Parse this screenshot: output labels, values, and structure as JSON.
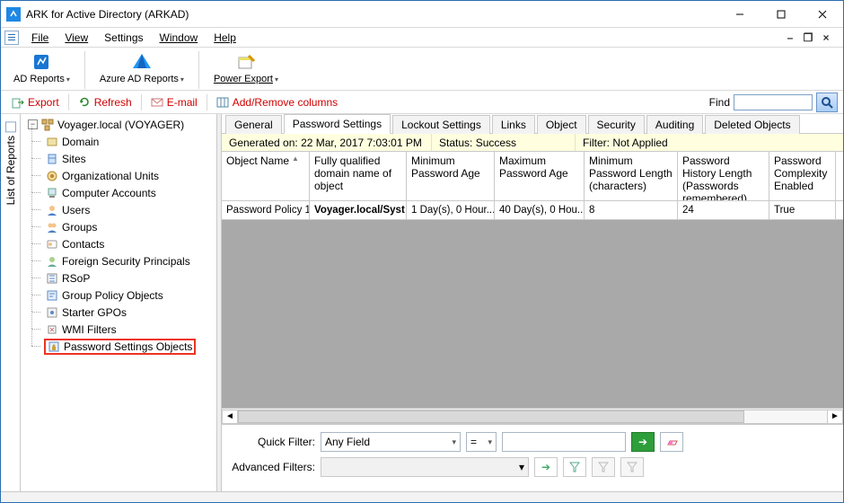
{
  "window": {
    "title": "ARK for Active Directory (ARKAD)"
  },
  "menu": {
    "file": "File",
    "view": "View",
    "settings": "Settings",
    "window": "Window",
    "help": "Help"
  },
  "ribbon": {
    "ad_reports": "AD Reports",
    "azure_reports": "Azure AD Reports",
    "power_export": "Power Export"
  },
  "toolbar": {
    "export": "Export",
    "refresh": "Refresh",
    "email": "E-mail",
    "addremove": "Add/Remove columns",
    "find_label": "Find"
  },
  "side_tab": "List of Reports",
  "tree": {
    "root": "Voyager.local (VOYAGER)",
    "items": [
      "Domain",
      "Sites",
      "Organizational Units",
      "Computer Accounts",
      "Users",
      "Groups",
      "Contacts",
      "Foreign Security Principals",
      "RSoP",
      "Group Policy Objects",
      "Starter GPOs",
      "WMI Filters",
      "Password Settings Objects"
    ]
  },
  "tabs": [
    "General",
    "Password Settings",
    "Lockout Settings",
    "Links",
    "Object",
    "Security",
    "Auditing",
    "Deleted Objects"
  ],
  "active_tab_index": 1,
  "infobar": {
    "generated_label": "Generated on:",
    "generated_value": "22 Mar, 2017 7:03:01 PM",
    "status_label": "Status:",
    "status_value": "Success",
    "filter_label": "Filter:",
    "filter_value": "Not Applied"
  },
  "grid": {
    "columns": [
      "Object Name",
      "Fully qualified domain name of object",
      "Minimum Password Age",
      "Maximum Password Age",
      "Minimum Password Length (characters)",
      "Password History Length (Passwords remembered)",
      "Password Complexity Enabled"
    ],
    "rows": [
      [
        "Password Policy 1",
        "Voyager.local/Syst",
        "1 Day(s), 0 Hour...",
        "40 Day(s), 0 Hou...",
        "8",
        "24",
        "True"
      ]
    ]
  },
  "filters": {
    "quick_label": "Quick Filter:",
    "quick_field": "Any Field",
    "quick_op": "=",
    "advanced_label": "Advanced Filters:"
  }
}
